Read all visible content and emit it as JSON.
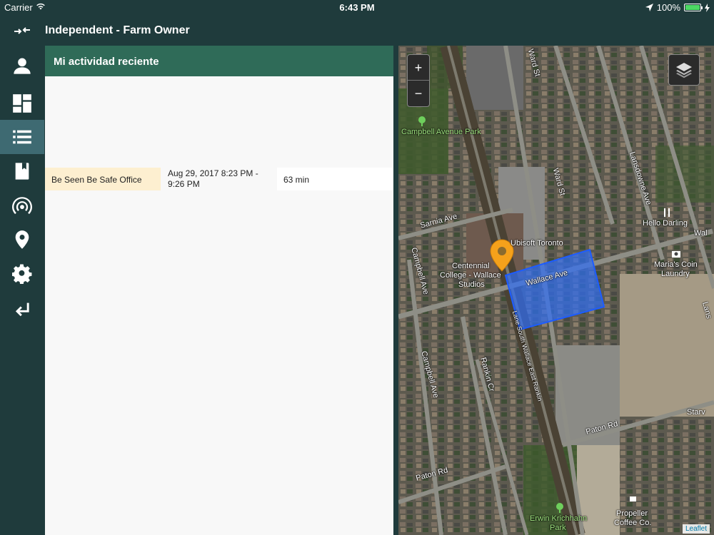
{
  "status_bar": {
    "carrier": "Carrier",
    "time": "6:43 PM",
    "battery": "100%"
  },
  "header": {
    "title": "Independent - Farm Owner"
  },
  "sidebar": {
    "items": [
      {
        "icon": "user-icon"
      },
      {
        "icon": "dashboard-icon"
      },
      {
        "icon": "list-icon",
        "active": true
      },
      {
        "icon": "book-icon"
      },
      {
        "icon": "broadcast-icon"
      },
      {
        "icon": "location-pin-icon"
      },
      {
        "icon": "gear-icon"
      },
      {
        "icon": "logout-icon"
      }
    ]
  },
  "activity": {
    "title": "Mi actividad reciente",
    "rows": [
      {
        "location": "Be Seen Be Safe Office",
        "time": "Aug 29, 2017 8:23 PM - 9:26 PM",
        "duration": "63 min"
      }
    ]
  },
  "map": {
    "zoom_in": "+",
    "zoom_out": "−",
    "attribution": "Leaflet",
    "labels": [
      "Ward St",
      "Campbell Avenue Park",
      "Ward St",
      "Lansdowne Ave",
      "Sarnia Ave",
      "Ubisoft Toronto",
      "Hello Darling",
      "Wal",
      "Campbell Ave",
      "Centennial",
      "College - Wallace",
      "Studios",
      "Wallace Ave",
      "Maria's Coin",
      "Laundry",
      "Lane South Wallace East Rankin",
      "Rankin Cr",
      "Campbell Ave",
      "Paton Rd",
      "Paton Rd",
      "Starv",
      "Erwin Krichhahn",
      "Park",
      "Propeller",
      "Coffee Co.",
      "Lans"
    ]
  },
  "colors": {
    "background": "#1f3b3c",
    "panel_header": "#2f6b58",
    "active_nav": "#3e6a72",
    "location_cell": "#fdefd0",
    "geofence": "#2f6df5",
    "marker": "#f5a11b"
  }
}
